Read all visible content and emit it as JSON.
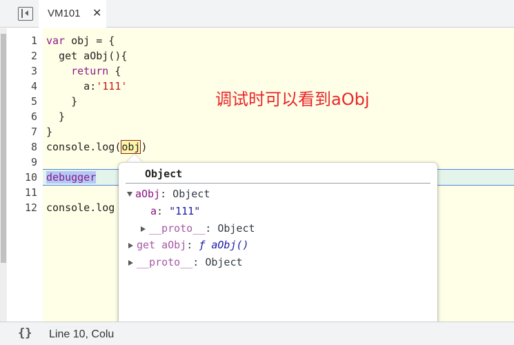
{
  "tab": {
    "label": "VM101",
    "close": "✕"
  },
  "code": {
    "lines": [
      "1",
      "2",
      "3",
      "4",
      "5",
      "6",
      "7",
      "8",
      "9",
      "10",
      "11",
      "12"
    ],
    "l1_kw": "var",
    "l1_rest": " obj = {",
    "l2": "  get aObj(){",
    "l3_indent": "    ",
    "l3_kw": "return",
    "l3_rest": " {",
    "l4_pre": "      a:",
    "l4_str": "'111'",
    "l5": "    }",
    "l6": "  }",
    "l7": "}",
    "l8_pre": "console.log(",
    "l8_obj": "obj",
    "l8_post": ")",
    "l10": "debugger",
    "l12": "console.log"
  },
  "annotation": "调试时可以看到aObj",
  "popover": {
    "title": "Object",
    "r1_name": "aObj",
    "r1_val": ": Object",
    "r2_name": "a",
    "r2_sep": ": ",
    "r2_val": "\"111\"",
    "r3_name": "__proto__",
    "r3_val": ": Object",
    "r4_name": "get aObj",
    "r4_sep": ": ",
    "r4_val": "ƒ aObj()",
    "r5_name": "__proto__",
    "r5_val": ": Object"
  },
  "status": {
    "braces": "{}",
    "text": "Line 10, Colu"
  },
  "colors": {
    "accent": "#4b86e5",
    "annotation": "#e8262b",
    "code_bg": "#fffee6"
  }
}
